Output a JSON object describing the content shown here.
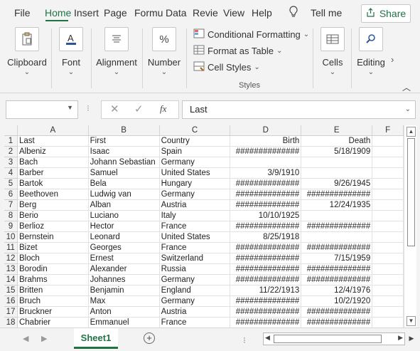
{
  "menu": {
    "items": [
      "File",
      "Home",
      "Insert",
      "Page",
      "Formu",
      "Data",
      "Revie",
      "View",
      "Help"
    ],
    "active": "Home",
    "tell_me": "Tell me",
    "share": "Share"
  },
  "ribbon": {
    "clipboard": "Clipboard",
    "font": "Font",
    "alignment": "Alignment",
    "number": "Number",
    "conditional_formatting": "Conditional Formatting",
    "format_as_table": "Format as Table",
    "cell_styles": "Cell Styles",
    "styles_caption": "Styles",
    "cells": "Cells",
    "editing": "Editing"
  },
  "formula_bar": {
    "name_box": "",
    "fx": "fx",
    "content": "Last"
  },
  "grid": {
    "columns": [
      "A",
      "B",
      "C",
      "D",
      "E",
      "F"
    ],
    "rows": [
      {
        "n": "1",
        "a": "Last",
        "b": "First",
        "c": "Country",
        "d": "Birth",
        "e": "Death"
      },
      {
        "n": "2",
        "a": "Albeniz",
        "b": "Isaac",
        "c": "Spain",
        "d": "##############",
        "e": "5/18/1909"
      },
      {
        "n": "3",
        "a": "Bach",
        "b": "Johann Sebastian",
        "c": "Germany",
        "d": "",
        "e": ""
      },
      {
        "n": "4",
        "a": "Barber",
        "b": "Samuel",
        "c": "United States",
        "d": "3/9/1910",
        "e": ""
      },
      {
        "n": "5",
        "a": "Bartok",
        "b": "Bela",
        "c": "Hungary",
        "d": "##############",
        "e": "9/26/1945"
      },
      {
        "n": "6",
        "a": "Beethoven",
        "b": "Ludwig van",
        "c": "Germany",
        "d": "##############",
        "e": "##############"
      },
      {
        "n": "7",
        "a": "Berg",
        "b": "Alban",
        "c": "Austria",
        "d": "##############",
        "e": "12/24/1935"
      },
      {
        "n": "8",
        "a": "Berio",
        "b": "Luciano",
        "c": "Italy",
        "d": "10/10/1925",
        "e": ""
      },
      {
        "n": "9",
        "a": "Berlioz",
        "b": "Hector",
        "c": "France",
        "d": "##############",
        "e": "##############"
      },
      {
        "n": "10",
        "a": "Bernstein",
        "b": "Leonard",
        "c": "United States",
        "d": "8/25/1918",
        "e": ""
      },
      {
        "n": "11",
        "a": "Bizet",
        "b": "Georges",
        "c": "France",
        "d": "##############",
        "e": "##############"
      },
      {
        "n": "12",
        "a": "Bloch",
        "b": "Ernest",
        "c": "Switzerland",
        "d": "##############",
        "e": "7/15/1959"
      },
      {
        "n": "13",
        "a": "Borodin",
        "b": "Alexander",
        "c": "Russia",
        "d": "##############",
        "e": "##############"
      },
      {
        "n": "14",
        "a": "Brahms",
        "b": "Johannes",
        "c": "Germany",
        "d": "##############",
        "e": "##############"
      },
      {
        "n": "15",
        "a": "Britten",
        "b": "Benjamin",
        "c": "England",
        "d": "11/22/1913",
        "e": "12/4/1976"
      },
      {
        "n": "16",
        "a": "Bruch",
        "b": "Max",
        "c": "Germany",
        "d": "##############",
        "e": "10/2/1920"
      },
      {
        "n": "17",
        "a": "Bruckner",
        "b": "Anton",
        "c": "Austria",
        "d": "##############",
        "e": "##############"
      },
      {
        "n": "18",
        "a": "Chabrier",
        "b": "Emmanuel",
        "c": "France",
        "d": "##############",
        "e": "##############"
      }
    ]
  },
  "sheets": {
    "active": "Sheet1"
  },
  "colors": {
    "accent": "#217346"
  }
}
